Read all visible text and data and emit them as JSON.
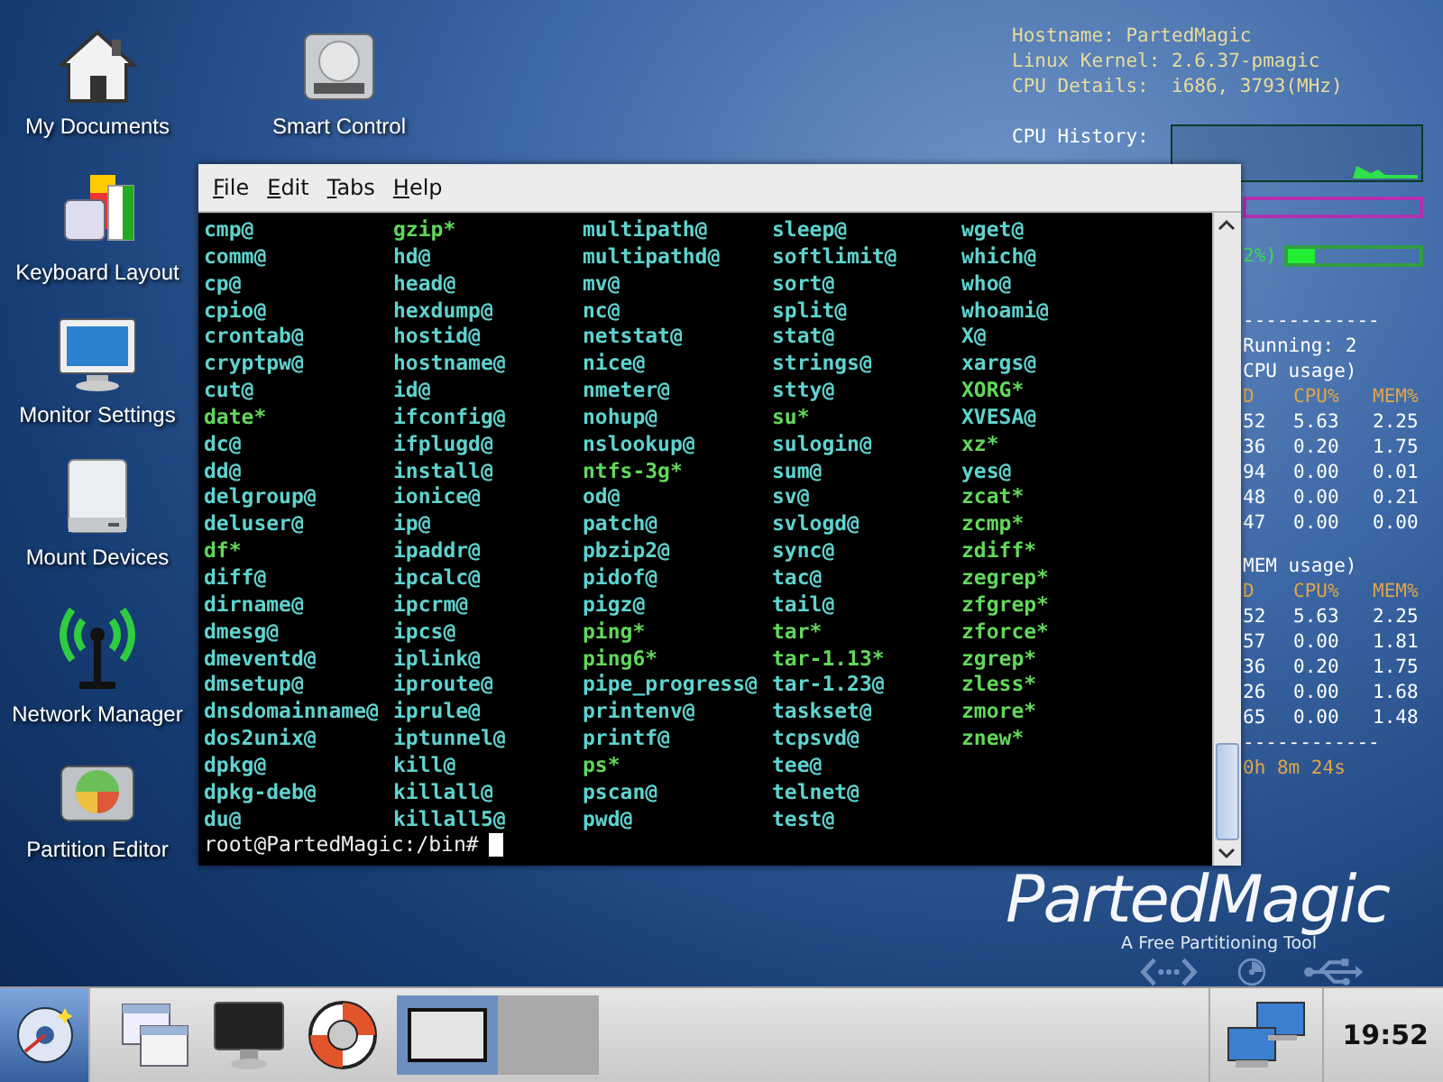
{
  "desktop_icons": [
    [
      {
        "label": "My Documents",
        "kind": "home"
      },
      {
        "label": "Keyboard Layout",
        "kind": "keyboard"
      },
      {
        "label": "Monitor Settings",
        "kind": "monitor"
      },
      {
        "label": "Mount Devices",
        "kind": "drive"
      },
      {
        "label": "Network Manager",
        "kind": "antenna"
      },
      {
        "label": "Partition Editor",
        "kind": "partition"
      }
    ],
    [
      {
        "label": "Smart Control",
        "kind": "harddisk"
      }
    ]
  ],
  "conky": {
    "info": [
      "Hostname: PartedMagic",
      "Linux Kernel: 2.6.37-pmagic",
      "CPU Details:  i686, 3793(MHz)"
    ],
    "history_label": "CPU History:",
    "ram_bar": {
      "level": 0.0
    },
    "cpu_reading": "2%)",
    "cpu_bar": {
      "level": 0.2
    },
    "rule": "------------",
    "running": "Running: 2",
    "tables": [
      {
        "title": "CPU usage)",
        "columns": [
          "D",
          "CPU%",
          "MEM%"
        ],
        "rows": [
          [
            "52",
            "5.63",
            "2.25"
          ],
          [
            "36",
            "0.20",
            "1.75"
          ],
          [
            "94",
            "0.00",
            "0.01"
          ],
          [
            "48",
            "0.00",
            "0.21"
          ],
          [
            "47",
            "0.00",
            "0.00"
          ]
        ]
      },
      {
        "title": "MEM usage)",
        "columns": [
          "D",
          "CPU%",
          "MEM%"
        ],
        "rows": [
          [
            "52",
            "5.63",
            "2.25"
          ],
          [
            "57",
            "0.00",
            "1.81"
          ],
          [
            "36",
            "0.20",
            "1.75"
          ],
          [
            "26",
            "0.00",
            "1.68"
          ],
          [
            "65",
            "0.00",
            "1.48"
          ]
        ]
      }
    ],
    "rule_bottom": "------------",
    "uptime": "0h 8m 24s"
  },
  "logo": {
    "name": "PartedMagic",
    "tagline": "A Free Partitioning Tool"
  },
  "terminal": {
    "menu": [
      "File",
      "Edit",
      "Tabs",
      "Help"
    ],
    "columns": [
      [
        {
          "name": "cmp@",
          "kind": "link"
        },
        {
          "name": "comm@",
          "kind": "link"
        },
        {
          "name": "cp@",
          "kind": "link"
        },
        {
          "name": "cpio@",
          "kind": "link"
        },
        {
          "name": "crontab@",
          "kind": "link"
        },
        {
          "name": "cryptpw@",
          "kind": "link"
        },
        {
          "name": "cut@",
          "kind": "link"
        },
        {
          "name": "date*",
          "kind": "exec"
        },
        {
          "name": "dc@",
          "kind": "link"
        },
        {
          "name": "dd@",
          "kind": "link"
        },
        {
          "name": "delgroup@",
          "kind": "link"
        },
        {
          "name": "deluser@",
          "kind": "link"
        },
        {
          "name": "df*",
          "kind": "exec"
        },
        {
          "name": "diff@",
          "kind": "link"
        },
        {
          "name": "dirname@",
          "kind": "link"
        },
        {
          "name": "dmesg@",
          "kind": "link"
        },
        {
          "name": "dmeventd@",
          "kind": "link"
        },
        {
          "name": "dmsetup@",
          "kind": "link"
        },
        {
          "name": "dnsdomainname@",
          "kind": "link"
        },
        {
          "name": "dos2unix@",
          "kind": "link"
        },
        {
          "name": "dpkg@",
          "kind": "link"
        },
        {
          "name": "dpkg-deb@",
          "kind": "link"
        },
        {
          "name": "du@",
          "kind": "link"
        }
      ],
      [
        {
          "name": "gzip*",
          "kind": "exec"
        },
        {
          "name": "hd@",
          "kind": "link"
        },
        {
          "name": "head@",
          "kind": "link"
        },
        {
          "name": "hexdump@",
          "kind": "link"
        },
        {
          "name": "hostid@",
          "kind": "link"
        },
        {
          "name": "hostname@",
          "kind": "link"
        },
        {
          "name": "id@",
          "kind": "link"
        },
        {
          "name": "ifconfig@",
          "kind": "link"
        },
        {
          "name": "ifplugd@",
          "kind": "link"
        },
        {
          "name": "install@",
          "kind": "link"
        },
        {
          "name": "ionice@",
          "kind": "link"
        },
        {
          "name": "ip@",
          "kind": "link"
        },
        {
          "name": "ipaddr@",
          "kind": "link"
        },
        {
          "name": "ipcalc@",
          "kind": "link"
        },
        {
          "name": "ipcrm@",
          "kind": "link"
        },
        {
          "name": "ipcs@",
          "kind": "link"
        },
        {
          "name": "iplink@",
          "kind": "link"
        },
        {
          "name": "iproute@",
          "kind": "link"
        },
        {
          "name": "iprule@",
          "kind": "link"
        },
        {
          "name": "iptunnel@",
          "kind": "link"
        },
        {
          "name": "kill@",
          "kind": "link"
        },
        {
          "name": "killall@",
          "kind": "link"
        },
        {
          "name": "killall5@",
          "kind": "link"
        }
      ],
      [
        {
          "name": "multipath@",
          "kind": "link"
        },
        {
          "name": "multipathd@",
          "kind": "link"
        },
        {
          "name": "mv@",
          "kind": "link"
        },
        {
          "name": "nc@",
          "kind": "link"
        },
        {
          "name": "netstat@",
          "kind": "link"
        },
        {
          "name": "nice@",
          "kind": "link"
        },
        {
          "name": "nmeter@",
          "kind": "link"
        },
        {
          "name": "nohup@",
          "kind": "link"
        },
        {
          "name": "nslookup@",
          "kind": "link"
        },
        {
          "name": "ntfs-3g*",
          "kind": "exec"
        },
        {
          "name": "od@",
          "kind": "link"
        },
        {
          "name": "patch@",
          "kind": "link"
        },
        {
          "name": "pbzip2@",
          "kind": "link"
        },
        {
          "name": "pidof@",
          "kind": "link"
        },
        {
          "name": "pigz@",
          "kind": "link"
        },
        {
          "name": "ping*",
          "kind": "exec"
        },
        {
          "name": "ping6*",
          "kind": "exec"
        },
        {
          "name": "pipe_progress@",
          "kind": "link"
        },
        {
          "name": "printenv@",
          "kind": "link"
        },
        {
          "name": "printf@",
          "kind": "link"
        },
        {
          "name": "ps*",
          "kind": "exec"
        },
        {
          "name": "pscan@",
          "kind": "link"
        },
        {
          "name": "pwd@",
          "kind": "link"
        }
      ],
      [
        {
          "name": "sleep@",
          "kind": "link"
        },
        {
          "name": "softlimit@",
          "kind": "link"
        },
        {
          "name": "sort@",
          "kind": "link"
        },
        {
          "name": "split@",
          "kind": "link"
        },
        {
          "name": "stat@",
          "kind": "link"
        },
        {
          "name": "strings@",
          "kind": "link"
        },
        {
          "name": "stty@",
          "kind": "link"
        },
        {
          "name": "su*",
          "kind": "exec"
        },
        {
          "name": "sulogin@",
          "kind": "link"
        },
        {
          "name": "sum@",
          "kind": "link"
        },
        {
          "name": "sv@",
          "kind": "link"
        },
        {
          "name": "svlogd@",
          "kind": "link"
        },
        {
          "name": "sync@",
          "kind": "link"
        },
        {
          "name": "tac@",
          "kind": "link"
        },
        {
          "name": "tail@",
          "kind": "link"
        },
        {
          "name": "tar*",
          "kind": "exec"
        },
        {
          "name": "tar-1.13*",
          "kind": "exec"
        },
        {
          "name": "tar-1.23@",
          "kind": "link"
        },
        {
          "name": "taskset@",
          "kind": "link"
        },
        {
          "name": "tcpsvd@",
          "kind": "link"
        },
        {
          "name": "tee@",
          "kind": "link"
        },
        {
          "name": "telnet@",
          "kind": "link"
        },
        {
          "name": "test@",
          "kind": "link"
        }
      ],
      [
        {
          "name": "wget@",
          "kind": "link"
        },
        {
          "name": "which@",
          "kind": "link"
        },
        {
          "name": "who@",
          "kind": "link"
        },
        {
          "name": "whoami@",
          "kind": "link"
        },
        {
          "name": "X@",
          "kind": "link"
        },
        {
          "name": "xargs@",
          "kind": "link"
        },
        {
          "name": "XORG*",
          "kind": "exec"
        },
        {
          "name": "XVESA@",
          "kind": "link"
        },
        {
          "name": "xz*",
          "kind": "exec"
        },
        {
          "name": "yes@",
          "kind": "link"
        },
        {
          "name": "zcat*",
          "kind": "exec"
        },
        {
          "name": "zcmp*",
          "kind": "exec"
        },
        {
          "name": "zdiff*",
          "kind": "exec"
        },
        {
          "name": "zegrep*",
          "kind": "exec"
        },
        {
          "name": "zfgrep*",
          "kind": "exec"
        },
        {
          "name": "zforce*",
          "kind": "exec"
        },
        {
          "name": "zgrep*",
          "kind": "exec"
        },
        {
          "name": "zless*",
          "kind": "exec"
        },
        {
          "name": "zmore*",
          "kind": "exec"
        },
        {
          "name": "znew*",
          "kind": "exec"
        }
      ]
    ],
    "prompt": "root@PartedMagic:/bin#"
  },
  "taskbar": {
    "launchers": [
      {
        "kind": "windows"
      },
      {
        "kind": "monitor"
      },
      {
        "kind": "lifebuoy"
      }
    ],
    "tasks": [
      {
        "selected": true
      },
      {
        "selected": false
      }
    ],
    "clock": "19:52"
  }
}
